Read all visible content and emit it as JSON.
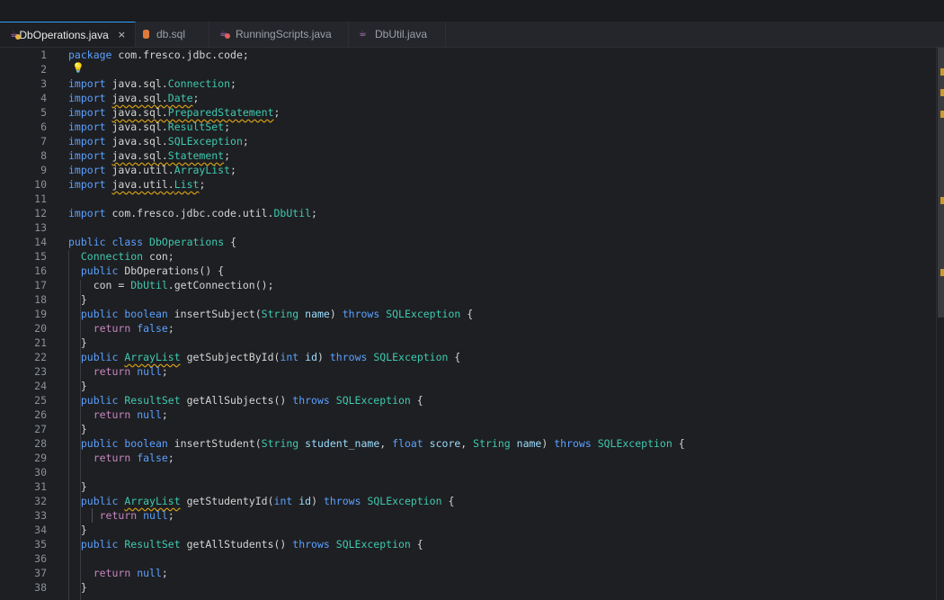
{
  "tabs": [
    {
      "label": "DbOperations.java",
      "active": true,
      "close": "×"
    },
    {
      "label": "db.sql"
    },
    {
      "label": "RunningScripts.java"
    },
    {
      "label": "DbUtil.java"
    }
  ],
  "editor": {
    "line_numbers": [
      "1",
      "2",
      "3",
      "4",
      "5",
      "6",
      "7",
      "8",
      "9",
      "10",
      "11",
      "12",
      "13",
      "14",
      "15",
      "16",
      "17",
      "18",
      "19",
      "20",
      "21",
      "22",
      "23",
      "24",
      "25",
      "26",
      "27",
      "28",
      "29",
      "30",
      "31",
      "32",
      "33",
      "34",
      "35",
      "36",
      "37",
      "38"
    ]
  },
  "colors": {
    "keyword": "#5aa0ff",
    "return_keyword": "#c586c0",
    "type": "#3fc9b0",
    "param": "#9cdcfe",
    "warning": "#d4a017",
    "tab_accent": "#2fa0ff"
  },
  "icons": {
    "lightbulb": "lightbulb-icon",
    "java_file": "java-file-icon",
    "sql_file": "database-file-icon"
  }
}
